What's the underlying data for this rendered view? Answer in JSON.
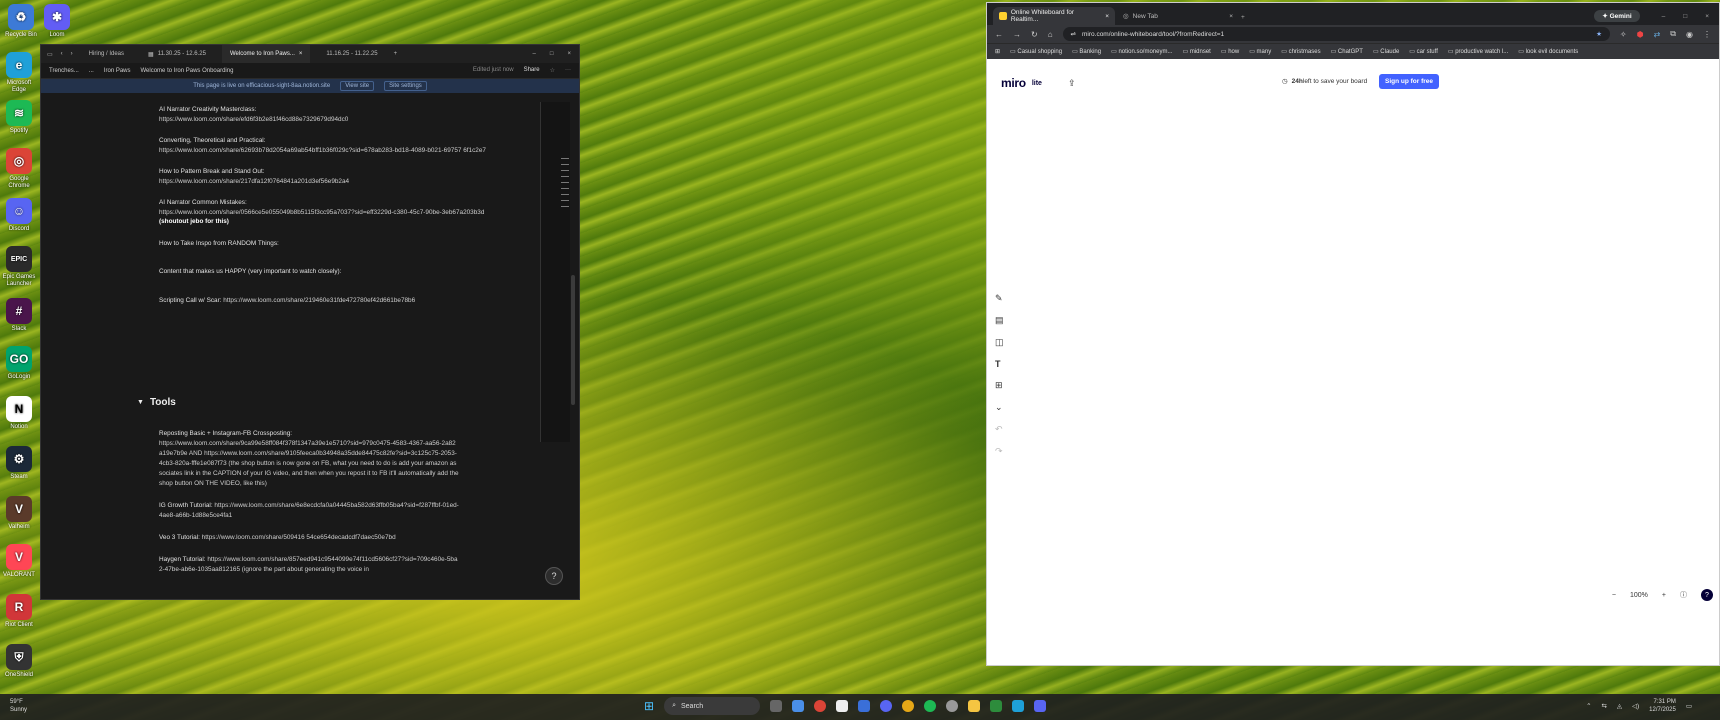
{
  "desktop": {
    "icons": [
      {
        "label": "Recycle Bin",
        "color": "#3d7ad6",
        "glyph": "♻"
      },
      {
        "label": "Loom",
        "color": "#625df5",
        "glyph": "✱"
      },
      {
        "label": "Microsoft Edge",
        "color": "#1fa0d8",
        "glyph": "e"
      },
      {
        "label": "Spotify",
        "color": "#1db954",
        "glyph": "≋"
      },
      {
        "label": "Google Chrome",
        "color": "#db4437",
        "glyph": "◎"
      },
      {
        "label": "Discord",
        "color": "#5865f2",
        "glyph": "☺"
      },
      {
        "label": "Epic Games Launcher",
        "color": "#2a2a2a",
        "glyph": "EPIC"
      },
      {
        "label": "Slack",
        "color": "#4a154b",
        "glyph": "#"
      },
      {
        "label": "GoLogin",
        "color": "#00a36c",
        "glyph": "GO"
      },
      {
        "label": "Notion",
        "color": "#ffffff",
        "glyph": "N"
      },
      {
        "label": "Steam",
        "color": "#1b2838",
        "glyph": "⚙"
      },
      {
        "label": "Valheim",
        "color": "#5a3a2a",
        "glyph": "V"
      },
      {
        "label": "VALORANT",
        "color": "#ff4655",
        "glyph": "V"
      },
      {
        "label": "Riot Client",
        "color": "#d13639",
        "glyph": "R"
      },
      {
        "label": "OneShield",
        "color": "#333333",
        "glyph": "⛨"
      }
    ]
  },
  "notion": {
    "tabs": [
      "Hiring / Ideas",
      "11.30.25 - 12.6.25",
      "Welcome to Iron Paws...",
      "11.16.25 - 11.22.25"
    ],
    "breadcrumb": [
      "Trenches...",
      "...",
      "Iron Paws",
      "Welcome to Iron Paws Onboarding"
    ],
    "edited": "Edited just now",
    "share": "Share",
    "banner": "This page is live on efficacious-sight-8aa.notion.site",
    "view_site": "View site",
    "site_settings": "Site settings",
    "blocks": [
      {
        "label": "AI Narrator Creativity Masterclass:",
        "link": "https://www.loom.com/share/efd6f3b2e81f46cd88e7329679d94dc0",
        "extra": ""
      },
      {
        "label": "Converting, Theoretical and Practical:",
        "link": "https://www.loom.com/share/62693b78d2054a69ab54bff1b36f029c?sid=678ab283-bd18-4089-b021-69757 6f1c2e7",
        "extra": ""
      },
      {
        "label": "How to Pattern Break and Stand Out:",
        "link": "https://www.loom.com/share/217dfa12f0764841a201d3ef56e9b2a4",
        "extra": ""
      },
      {
        "label": "AI Narrator Common Mistakes:",
        "link": "https://www.loom.com/share/0566ce5e055049b8b5115f3cc95a7037?sid=eff3229d-c380-45c7-90be-3eb67a203b3d",
        "extra": "(shoutout jebo for this)"
      },
      {
        "label": "How to Take Inspo from RANDOM Things:",
        "link": "",
        "extra": ""
      },
      {
        "label": "Content that makes us HAPPY (very important to watch closely):",
        "link": "",
        "extra": ""
      },
      {
        "label": "Scripting Call w/ Scar:",
        "link": "https://www.loom.com/share/219460e31fde472780ef42d661be78b6",
        "extra": ""
      }
    ],
    "tools_heading": "Tools",
    "tools": [
      {
        "label": "Reposting Basic + Instagram-FB Crossposting:",
        "text": "https://www.loom.com/share/9ca99e58ff084f378f1347a39e1e5710?sid=979c0475-4583-4367-aa56-2a82a19e7b9e AND https://www.loom.com/share/9105feeca0b34948a35dde84475c82fe?sid=3c125c75-2053-4cb3-820a-fffe1e087f73 (the shop button is now gone on FB, what you need to do is add your amazon associates link in the CAPTION of your IG video, and then when you repost it to FB it'll automatically add the shop button ON THE VIDEO, like this)"
      },
      {
        "label": "IG Growth Tutorial:",
        "text": "https://www.loom.com/share/6e8ecdcfa0a04445ba582d63ffb05ba4?sid=f287ffbf-01ed-4ae8-a66b-1d88e5ce4fa1"
      },
      {
        "label": "Veo 3 Tutorial:",
        "text": "https://www.loom.com/share/509416 54ce654decadcdf7daec50e7bd"
      },
      {
        "label": "Haygen Tutorial:",
        "text": "https://www.loom.com/share/857eed941c9544099e74f11cd5606cf27?sid=709c460e-5ba2-47be-ab6e-1035aa812165 (ignore the part about generating the voice in"
      }
    ]
  },
  "chrome": {
    "tabs": [
      {
        "title": "Online Whiteboard for Realtim..."
      },
      {
        "title": "New Tab"
      }
    ],
    "gemini": "Gemini",
    "url": "miro.com/online-whiteboard/tool/?fromRedirect=1",
    "bookmarks": [
      "Casual shopping",
      "Banking",
      "notion.so/moneym...",
      "midnset",
      "how",
      "many",
      "christmases",
      "ChatGPT",
      "Claude",
      "car stuff",
      "productive watch l...",
      "look evil documents"
    ]
  },
  "miro": {
    "logo": "miro",
    "lite": "lite",
    "save_prefix": "24h",
    "save_text": " left to save your board",
    "signup": "Sign up for free",
    "zoom": "100%",
    "accent": "#4262ff"
  },
  "taskbar": {
    "weather_temp": "59°F",
    "weather_desc": "Sunny",
    "search": "Search",
    "time": "7:31 PM",
    "date": "12/7/2025"
  }
}
